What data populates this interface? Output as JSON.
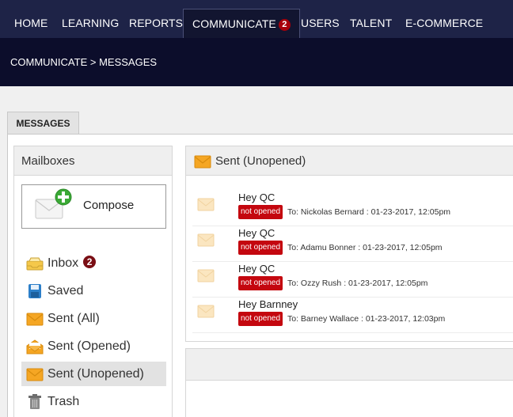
{
  "nav": {
    "items": [
      {
        "label": "HOME"
      },
      {
        "label": "LEARNING"
      },
      {
        "label": "REPORTS"
      },
      {
        "label": "COMMUNICATE",
        "badge": "2"
      },
      {
        "label": "USERS"
      },
      {
        "label": "TALENT"
      },
      {
        "label": "E-COMMERCE"
      }
    ],
    "active": "COMMUNICATE"
  },
  "breadcrumb": "COMMUNICATE > MESSAGES",
  "tab": {
    "label": "MESSAGES"
  },
  "mailboxes": {
    "title": "Mailboxes",
    "compose_label": "Compose",
    "items": [
      {
        "label": "Inbox",
        "badge": "2",
        "icon": "inbox-icon"
      },
      {
        "label": "Saved",
        "icon": "save-icon"
      },
      {
        "label": "Sent (All)",
        "icon": "envelope-icon"
      },
      {
        "label": "Sent (Opened)",
        "icon": "open-envelope-icon"
      },
      {
        "label": "Sent (Unopened)",
        "icon": "envelope-icon"
      },
      {
        "label": "Trash",
        "icon": "trash-icon"
      }
    ],
    "selected": "Sent (Unopened)"
  },
  "list": {
    "title": "Sent (Unopened)",
    "messages": [
      {
        "subject": "Hey QC",
        "status": "not opened",
        "meta": "To: Nickolas Bernard : 01-23-2017, 12:05pm"
      },
      {
        "subject": "Hey QC",
        "status": "not opened",
        "meta": "To: Adamu Bonner : 01-23-2017, 12:05pm"
      },
      {
        "subject": "Hey QC",
        "status": "not opened",
        "meta": "To: Ozzy Rush : 01-23-2017, 12:05pm"
      },
      {
        "subject": "Hey Barnney",
        "status": "not opened",
        "meta": "To: Barney Wallace : 01-23-2017, 12:03pm"
      }
    ]
  },
  "colors": {
    "nav_bg": "#1e2347",
    "subhead_bg": "#0c0d2b",
    "badge_red": "#c4070f",
    "envelope_orange": "#f5a623"
  }
}
